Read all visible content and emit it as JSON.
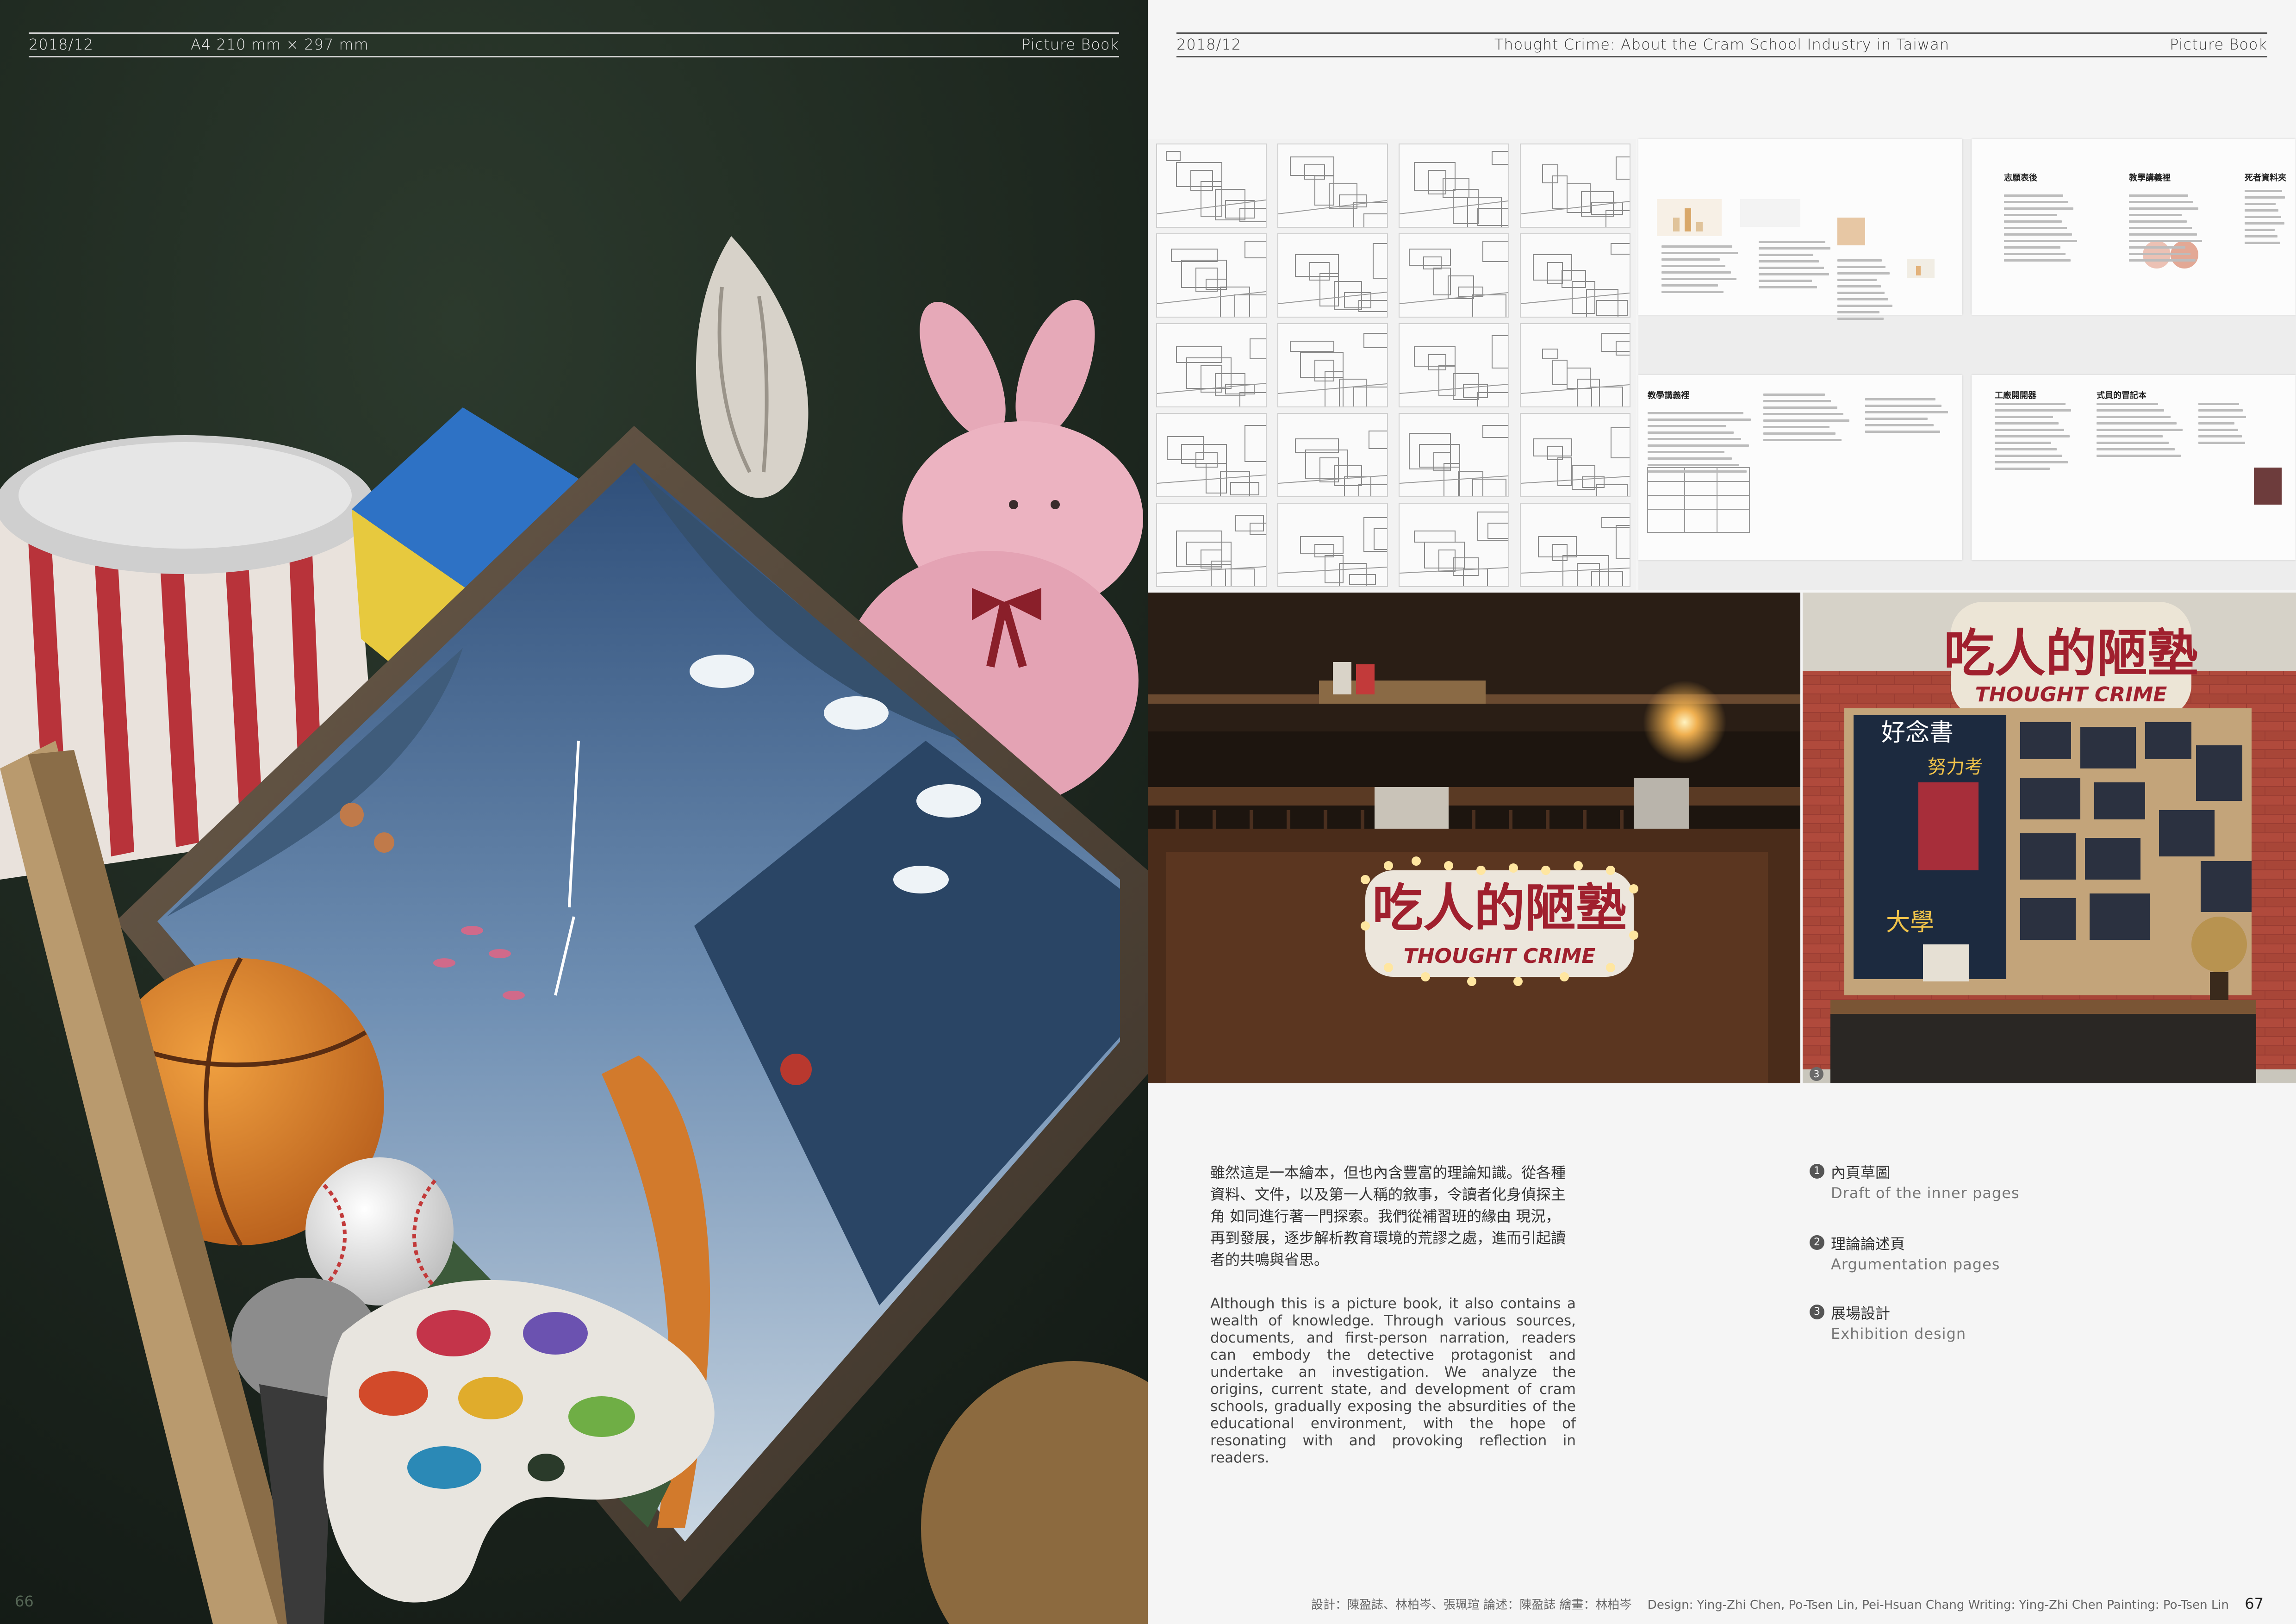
{
  "left_header": {
    "date": "2018/12",
    "size": "A4 210 mm × 297 mm",
    "section": "Picture Book"
  },
  "right_header": {
    "date": "2018/12",
    "title": "Thought Crime: About the Cram School Industry in Taiwan",
    "section": "Picture Book"
  },
  "left_page_number": "66",
  "right_page_number": "67",
  "figure_markers": [
    "1",
    "2"
  ],
  "photo_marker": "3",
  "sign_text_zh": "吃人的陋塾",
  "sign_text_en": "THOUGHT CRIME",
  "board_texts": [
    "好念書",
    "努力考",
    "大學"
  ],
  "argu_headings": [
    "志願表後",
    "教學講義裡",
    "死者資料夾",
    "教學講義裡",
    "工廠開開器",
    "式員的冒記本"
  ],
  "body_zh": "雖然這是一本繪本，但也內含豐富的理論知識。從各種資料、文件，以及第一人稱的敘事，令讀者化身偵探主角 如同進行著一門探索。我們從補習班的緣由 現況，再到發展，逐步解析教育環境的荒謬之處，進而引起讀者的共鳴與省思。",
  "body_en": "Although this is a picture book, it also contains a wealth of knowledge. Through various sources, documents, and first-person narration, readers can embody the detective protagonist and undertake an investigation. We analyze the origins, current state, and development of cram schools, gradually exposing the absurdities of the educational environment, with the hope of resonating with and provoking reflection in readers.",
  "legend": [
    {
      "num": "1",
      "zh": "內頁草圖",
      "en": "Draft of the inner pages"
    },
    {
      "num": "2",
      "zh": "理論論述頁",
      "en": "Argumentation pages"
    },
    {
      "num": "3",
      "zh": "展場設計",
      "en": "Exhibition design"
    }
  ],
  "credits_zh": "設計：陳盈誌、林柏岑、張珮瑄 論述：陳盈誌 繪畫：林柏岑",
  "credits_en": "Design: Ying-Zhi Chen, Po-Tsen Lin, Pei-Hsuan Chang Writing: Ying-Zhi Chen Painting: Po-Tsen Lin",
  "colors": {
    "left_bg": "#1f2a22",
    "right_bg": "#f5f5f5",
    "sign_red": "#a0202e",
    "marker": "#5a5a5a"
  }
}
